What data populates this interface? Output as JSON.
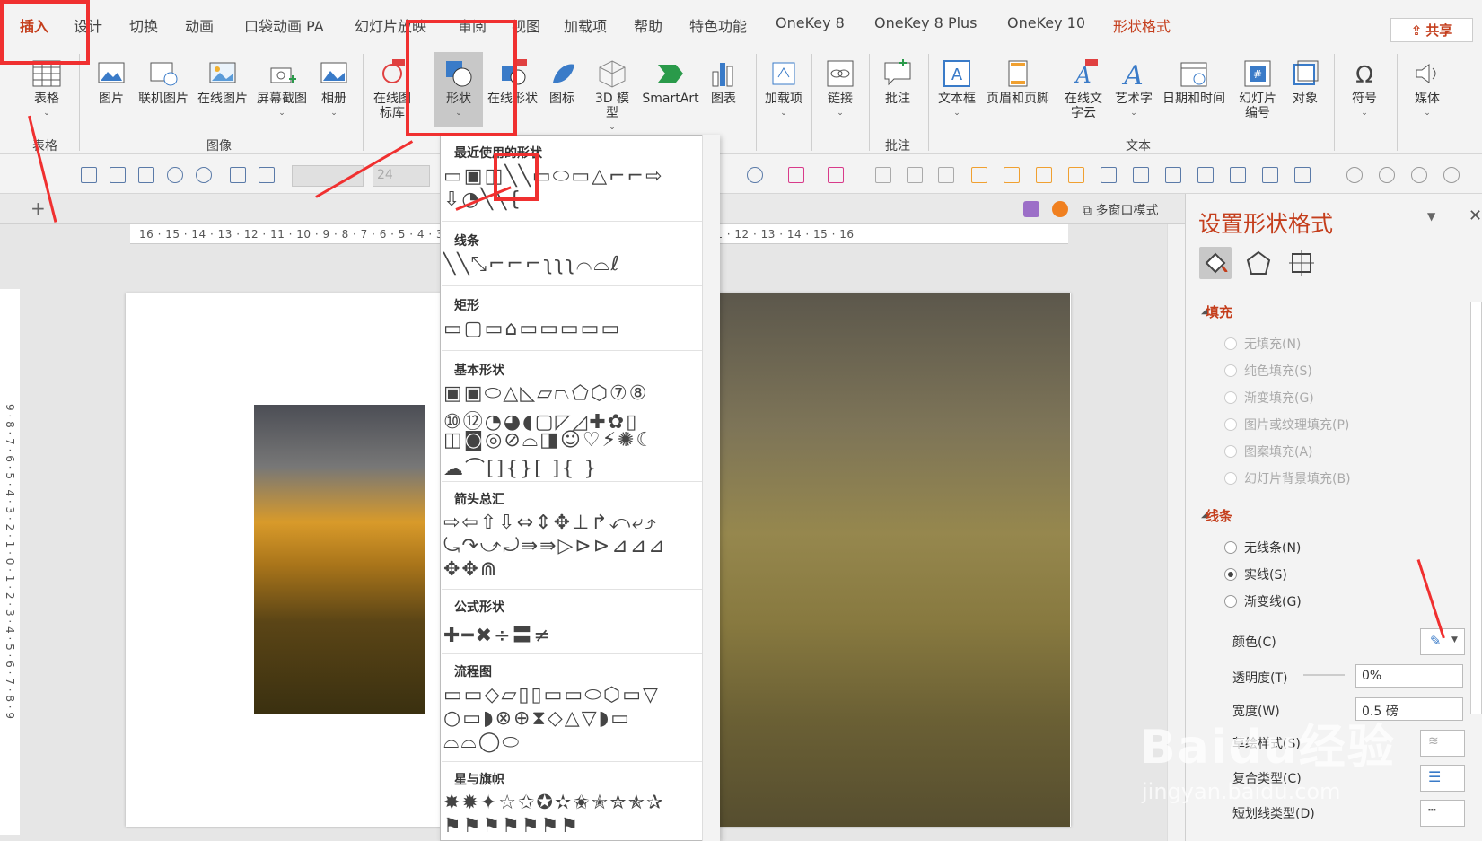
{
  "tabs": [
    "插入",
    "设计",
    "切换",
    "动画",
    "口袋动画 PA",
    "幻灯片放映",
    "审阅",
    "视图",
    "加载项",
    "帮助",
    "特色功能",
    "OneKey 8",
    "OneKey 8 Plus",
    "OneKey 10",
    "形状格式"
  ],
  "share_label": "共享",
  "ribbon": {
    "table": {
      "label": "表格",
      "group": "表格"
    },
    "image_group": "图像",
    "images": [
      "图片",
      "联机图片",
      "在线图片",
      "屏幕截图",
      "相册"
    ],
    "online_icons": "在线图标库",
    "shapes": "形状",
    "online_shapes": "在线形状",
    "icons": "图标",
    "model3d": "3D 模型",
    "smartart": "SmartArt",
    "chart": "图表",
    "addins": "加载项",
    "link": "链接",
    "comment": "批注",
    "comment_group": "批注",
    "text_items": [
      "文本框",
      "页眉和页脚",
      "在线文字云",
      "艺术字",
      "日期和时间",
      "幻灯片编号",
      "对象"
    ],
    "text_group": "文本",
    "symbol": "符号",
    "media": "媒体"
  },
  "qbar": {
    "font_size": "24"
  },
  "tabstrip": {
    "multiwindow": "多窗口模式",
    "add": "+"
  },
  "ruler_h": "16 · 15 · 14 · 13 · 12 · 11 · 10 · 9 · 8 · 7 · 6 · 5 · 4 · 3 · 2 · 1 · 0 · 1 · 2 · 3 · 4 · 5 · 6 · 7 · 8 · 9 · 10 · 11 · 12 · 13 · 14 · 15 · 16",
  "ruler_v": "9 · 8 · 7 · 6 · 5 · 4 · 3 · 2 · 1 · 0 · 1 · 2 · 3 · 4 · 5 · 6 · 7 · 8 · 9",
  "dropdown": {
    "sections": [
      {
        "title": "最近使用的形状",
        "rows": [
          "▭▣◫╲╲▭⬭▭△⌐⌐⇨",
          "⇩◔╲╲{"
        ]
      },
      {
        "title": "线条",
        "rows": [
          "╲╲⤡⌐⌐⌐ʅʅʅ⌒⌓ℓ"
        ]
      },
      {
        "title": "矩形",
        "rows": [
          "▭▢▭⌂▭▭▭▭▭"
        ]
      },
      {
        "title": "基本形状",
        "rows": [
          "▣▣⬭△◺▱⏢⬠⬡⑦⑧",
          "⑩⑫◔◕◖▢◸◿✚✿▯",
          "◫◙◎⊘⌓◨☺♡⚡✺☾",
          "☁⌒[]{}[ ]{ }"
        ]
      },
      {
        "title": "箭头总汇",
        "rows": [
          "⇨⇦⇧⇩⇔⇕✥⊥↱⤺⤶⤴",
          "⤿↷⤻⤾⇛⇛▷⊳⊳⊿⊿⊿",
          "✥✥⋒"
        ]
      },
      {
        "title": "公式形状",
        "rows": [
          "✚━✖÷〓≠"
        ]
      },
      {
        "title": "流程图",
        "rows": [
          "▭▭◇▱▯▯▭▭⬭⬡▭▽",
          "○▭◗⊗⊕⧗◇△▽◗▭",
          "⌓⌓◯⬭"
        ]
      },
      {
        "title": "星与旗帜",
        "rows": [
          "✸✹✦☆✩✪✫✬✭✮✯✰",
          "⚑⚑⚑⚑⚑⚑⚑"
        ]
      }
    ]
  },
  "pane": {
    "title": "设置形状格式",
    "fill_section": "填充",
    "fill_options": [
      "无填充(N)",
      "纯色填充(S)",
      "渐变填充(G)",
      "图片或纹理填充(P)",
      "图案填充(A)",
      "幻灯片背景填充(B)"
    ],
    "line_section": "线条",
    "line_options": [
      "无线条(N)",
      "实线(S)",
      "渐变线(G)"
    ],
    "color_label": "颜色(C)",
    "transparency_label": "透明度(T)",
    "transparency_value": "0%",
    "width_label": "宽度(W)",
    "width_value": "0.5 磅",
    "compound_label": "复合类型(C)",
    "sketch_label": "草绘样式(S)",
    "dash_label": "短划线类型(D)"
  },
  "watermark": {
    "brand": "Baidu经验",
    "url": "jingyan.baidu.com"
  },
  "colors": {
    "accent": "#c43e1c",
    "annotation": "#f03030"
  }
}
